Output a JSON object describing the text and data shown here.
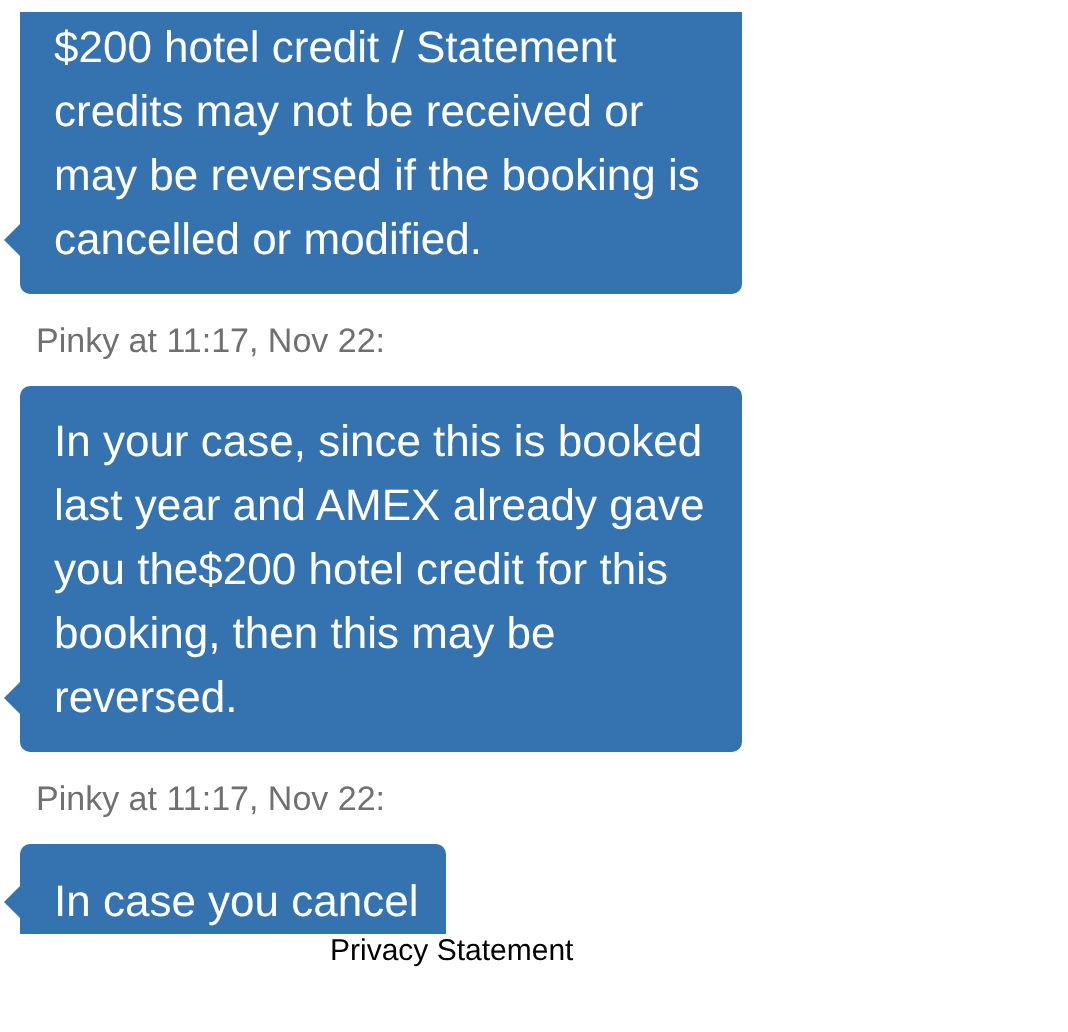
{
  "messages": [
    {
      "kind": "message",
      "text": "$200 hotel credit / Statement credits may not be received or may be reversed if the booking is cancelled or modified."
    },
    {
      "kind": "timestamp",
      "text": "Pinky at 11:17, Nov 22:"
    },
    {
      "kind": "message",
      "text": "In your case, since this is booked last year and AMEX already gave you the$200 hotel credit for this booking, then this may be reversed."
    },
    {
      "kind": "timestamp",
      "text": "Pinky at 11:17, Nov 22:"
    },
    {
      "kind": "message",
      "text": "In case you cancel"
    }
  ],
  "footer": {
    "link": "Privacy Statement"
  }
}
